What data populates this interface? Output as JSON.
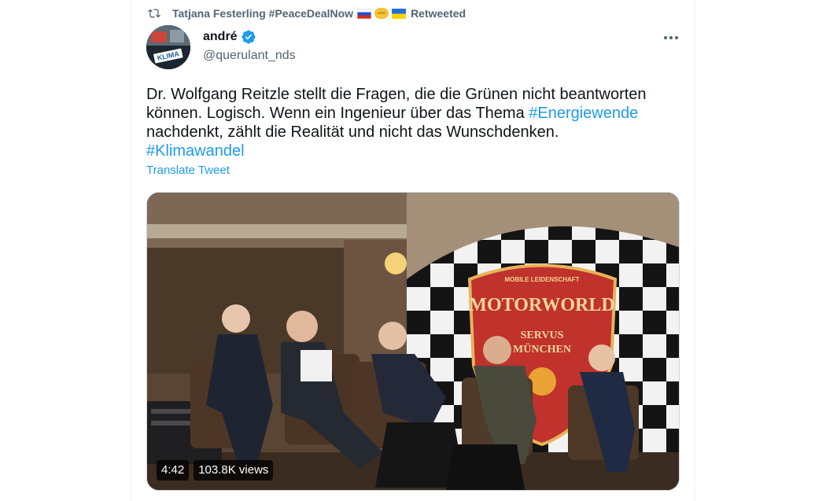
{
  "social_context": {
    "retweeter": "Tatjana Festerling #PeaceDealNow",
    "suffix": "Retweeted",
    "icon": "retweet-icon",
    "emojis": [
      "flag-russia",
      "handshake",
      "flag-ukraine"
    ]
  },
  "author": {
    "name": "andré",
    "handle": "@querulant_nds",
    "verified": true,
    "avatar_text": "KLIMA"
  },
  "tweet": {
    "line1": "Dr. Wolfgang Reitzle stellt die Fragen, die die Grünen nicht beantworten",
    "line2_text": "können. Logisch. Wenn ein Ingenieur über das Thema ",
    "line2_hashtag": "#Energiewende",
    "line3": "nachdenkt, zählt die Realität und nicht das Wunschdenken.",
    "line4_hashtag": "#Klimawandel",
    "translate_label": "Translate Tweet"
  },
  "media": {
    "duration": "4:42",
    "views": "103.8K views",
    "sign_top": "MOBILE LEIDENSCHAFT",
    "sign_main": "MOTORWORLD",
    "sign_sub1": "SERVUS",
    "sign_sub2": "MÜNCHEN"
  },
  "colors": {
    "link": "#1d9bf0",
    "secondary": "#536471",
    "text": "#0f1419"
  }
}
